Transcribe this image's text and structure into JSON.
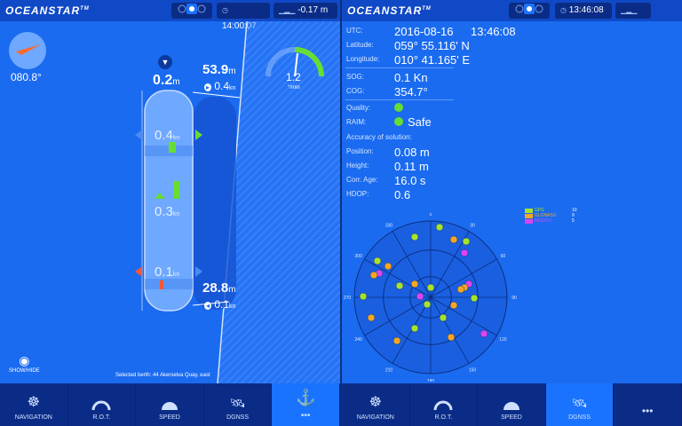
{
  "left": {
    "brand": "OCEANSTAR",
    "time": "14:00:07",
    "tide": "-0.17 m",
    "heading": "080.8°",
    "bow_distance": "0.2",
    "bow_distance_unit": "m",
    "bow_right_distance": "53.9",
    "bow_right_unit": "m",
    "bow_right_speed": "0.4",
    "speed_unit": "kn",
    "ship_speed_fwd": "0.4",
    "ship_speed_mid": "0.3",
    "ship_speed_aft": "0.1",
    "stern_right_distance": "28.8",
    "stern_right_unit": "m",
    "stern_right_speed": "0.1",
    "rot_value": "1.2",
    "rot_unit": "°/min",
    "show_hide": "SHOW/HIDE",
    "selected_berth": "Selected berth:  44 Akerselva Quay, east"
  },
  "right": {
    "brand": "OCEANSTAR",
    "time": "13:46:08",
    "utc_label": "UTC:",
    "utc_date": "2016-08-16",
    "utc_time": "13:46:08",
    "lat_label": "Latitude:",
    "lat": "059° 55.116' N",
    "lon_label": "Longitude:",
    "lon": "010° 41.165' E",
    "sog_label": "SOG:",
    "sog": "0.1 Kn",
    "cog_label": "COG:",
    "cog": "354.7°",
    "quality_label": "Quality:",
    "raim_label": "RAIM:",
    "raim": "Safe",
    "accuracy_label": "Accuracy of solution:",
    "position_label": "Position:",
    "position": "0.08 m",
    "height_label": "Height:",
    "height": "0.11 m",
    "corr_label": "Corr. Age:",
    "corr": "16.0 s",
    "hdop_label": "HDOP:",
    "hdop": "0.6",
    "legend": [
      {
        "name": "GPS",
        "count": "10",
        "color": "#a6e22e"
      },
      {
        "name": "GLONASS",
        "count": "9",
        "color": "#f5a623"
      },
      {
        "name": "BEIDOU",
        "count": "5",
        "color": "#d946ef"
      }
    ],
    "sky_labels": [
      "0",
      "30",
      "60",
      "90",
      "120",
      "150",
      "180",
      "210",
      "240",
      "270",
      "300",
      "330"
    ]
  },
  "nav_left": [
    "NAVIGATION",
    "R.O.T.",
    "SPEED",
    "DGNSS",
    ""
  ],
  "nav_right": [
    "NAVIGATION",
    "R.O.T.",
    "SPEED",
    "DGNSS",
    ""
  ],
  "colors": {
    "accent": "#1a6bf0",
    "dark": "#0b2c86",
    "gps": "#a6e22e",
    "glonass": "#f5a623",
    "beidou": "#d946ef"
  }
}
